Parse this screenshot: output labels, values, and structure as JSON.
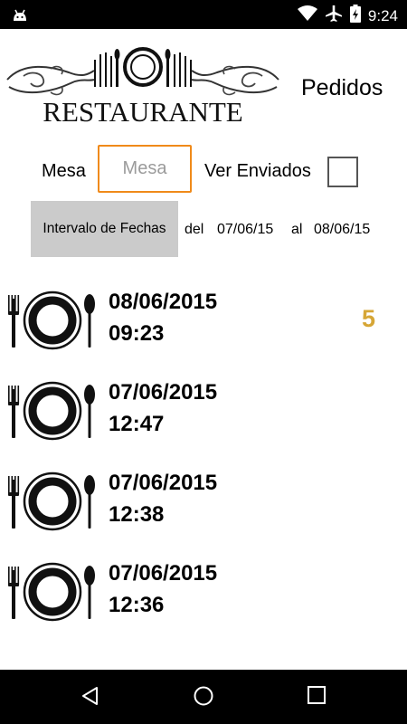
{
  "status_bar": {
    "time": "9:24",
    "icons": [
      "android-icon",
      "wifi-icon",
      "airplane-icon",
      "battery-charging-icon"
    ]
  },
  "header": {
    "logo_text": "RESTAURANTE",
    "title": "Pedidos"
  },
  "filters": {
    "mesa_label": "Mesa",
    "mesa_placeholder": "Mesa",
    "mesa_value": "",
    "ver_enviados_label": "Ver Enviados",
    "ver_enviados_checked": false,
    "interval_button_label": "Intervalo de Fechas",
    "del_label": "del",
    "from_date": "07/06/15",
    "al_label": "al",
    "to_date": "08/06/15"
  },
  "orders": [
    {
      "date": "08/06/2015",
      "time": "09:23",
      "count": "5"
    },
    {
      "date": "07/06/2015",
      "time": "12:47",
      "count": ""
    },
    {
      "date": "07/06/2015",
      "time": "12:38",
      "count": ""
    },
    {
      "date": "07/06/2015",
      "time": "12:36",
      "count": ""
    }
  ],
  "colors": {
    "accent_orange": "#f08a1a",
    "count_gold": "#d6a636",
    "interval_button_bg": "#cbcbcb"
  },
  "nav_bar": {
    "icons": [
      "back-icon",
      "home-icon",
      "recents-icon"
    ]
  }
}
